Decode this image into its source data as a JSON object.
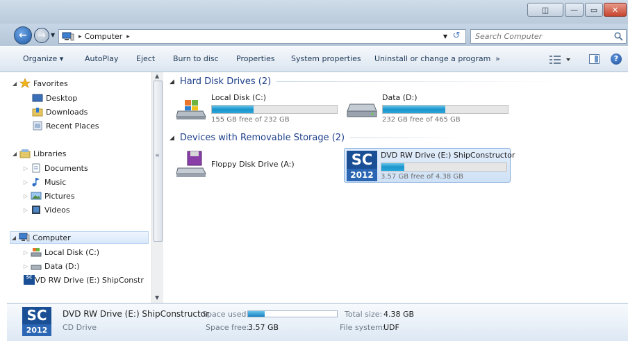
{
  "window": {
    "buttons": {
      "restore": "◫",
      "minimize": "—",
      "maximize": "▭",
      "close": "✕"
    }
  },
  "address_bar": {
    "location": "Computer",
    "separator": "▸",
    "search_placeholder": "Search Computer"
  },
  "toolbar": {
    "organize": "Organize ▾",
    "autoplay": "AutoPlay",
    "eject": "Eject",
    "burn": "Burn to disc",
    "properties": "Properties",
    "system_properties": "System properties",
    "uninstall": "Uninstall or change a program",
    "more": "»",
    "views_icon": "views-icon",
    "help": "?"
  },
  "nav": {
    "favorites": {
      "label": "Favorites",
      "items": [
        "Desktop",
        "Downloads",
        "Recent Places"
      ]
    },
    "libraries": {
      "label": "Libraries",
      "items": [
        "Documents",
        "Music",
        "Pictures",
        "Videos"
      ]
    },
    "computer": {
      "label": "Computer",
      "items": [
        "Local Disk (C:)",
        "Data (D:)",
        "DVD RW Drive (E:) ShipConstr"
      ]
    }
  },
  "content": {
    "groups": [
      {
        "label": "Hard Disk Drives (2)"
      },
      {
        "label": "Devices with Removable Storage (2)"
      }
    ],
    "drives": {
      "c": {
        "name": "Local Disk (C:)",
        "free_text": "155 GB free of 232 GB",
        "used_fraction": 0.332
      },
      "d": {
        "name": "Data (D:)",
        "free_text": "232 GB free of 465 GB",
        "used_fraction": 0.501
      },
      "a": {
        "name": "Floppy Disk Drive (A:)"
      },
      "e": {
        "name": "DVD RW Drive (E:) ShipConstructor",
        "free_text": "3.57 GB free of 4.38 GB",
        "used_fraction": 0.185
      }
    },
    "logo": {
      "text": "SC",
      "year": "2012"
    }
  },
  "details": {
    "name": "DVD RW Drive (E:) ShipConstructor",
    "type": "CD Drive",
    "space_used_label": "Space used:",
    "space_free_label": "Space free:",
    "space_free_value": "3.57 GB",
    "total_size_label": "Total size:",
    "total_size_value": "4.38 GB",
    "file_system_label": "File system:",
    "file_system_value": "UDF",
    "used_fraction": 0.185
  },
  "colors": {
    "accent": "#1a95cc",
    "group_header": "#1e3f8a",
    "logo_blue": "#1a4f96"
  }
}
